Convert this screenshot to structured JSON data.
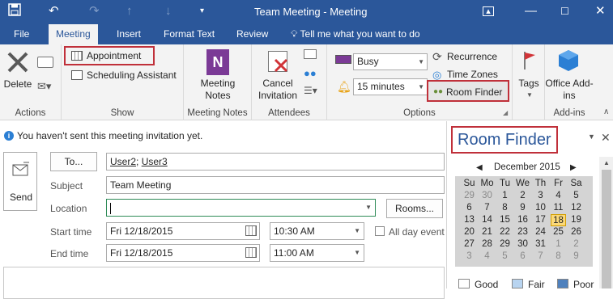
{
  "window": {
    "title": "Team Meeting - Meeting",
    "help": "?"
  },
  "tabs": [
    "File",
    "Meeting",
    "Insert",
    "Format Text",
    "Review"
  ],
  "tell_me": "Tell me what you want to do",
  "ribbon": {
    "delete_label": "Delete",
    "actions_label": "Actions",
    "appointment_label": "Appointment",
    "scheduling_label": "Scheduling Assistant",
    "show_label": "Show",
    "meeting_notes_label": "Meeting Notes",
    "meeting_notes_group": "Meeting Notes",
    "cancel_invitation_label": "Cancel Invitation",
    "attendees_label": "Attendees",
    "show_as_value": "Busy",
    "reminder_value": "15 minutes",
    "recurrence_label": "Recurrence",
    "time_zones_label": "Time Zones",
    "room_finder_label": "Room Finder",
    "options_label": "Options",
    "tags_label": "Tags",
    "office_addins_label": "Office Add-ins",
    "addins_label": "Add-ins"
  },
  "form": {
    "info": "You haven't sent this meeting invitation yet.",
    "send_label": "Send",
    "to_button": "To...",
    "to_value": [
      "User2",
      "User3"
    ],
    "subject_label": "Subject",
    "subject_value": "Team Meeting",
    "location_label": "Location",
    "location_value": "",
    "rooms_button": "Rooms...",
    "start_label": "Start time",
    "start_date": "Fri 12/18/2015",
    "start_time": "10:30 AM",
    "all_day_label": "All day event",
    "end_label": "End time",
    "end_date": "Fri 12/18/2015",
    "end_time": "11:00 AM"
  },
  "room_finder": {
    "title": "Room Finder",
    "month": "December 2015",
    "weekdays": [
      "Su",
      "Mo",
      "Tu",
      "We",
      "Th",
      "Fr",
      "Sa"
    ],
    "weeks": [
      [
        "29",
        "30",
        "1",
        "2",
        "3",
        "4",
        "5"
      ],
      [
        "6",
        "7",
        "8",
        "9",
        "10",
        "11",
        "12"
      ],
      [
        "13",
        "14",
        "15",
        "16",
        "17",
        "18",
        "19"
      ],
      [
        "20",
        "21",
        "22",
        "23",
        "24",
        "25",
        "26"
      ],
      [
        "27",
        "28",
        "29",
        "30",
        "31",
        "1",
        "2"
      ],
      [
        "3",
        "4",
        "5",
        "6",
        "7",
        "8",
        "9"
      ]
    ],
    "selected_day": "18",
    "legend": [
      "Good",
      "Fair",
      "Poor"
    ],
    "colors": {
      "good": "#ffffff",
      "fair": "#b8d4f0",
      "poor": "#4f81bd"
    }
  },
  "colors": {
    "brand": "#2b579a",
    "highlight": "#c0303a",
    "selected_day": "#fbd97a"
  }
}
